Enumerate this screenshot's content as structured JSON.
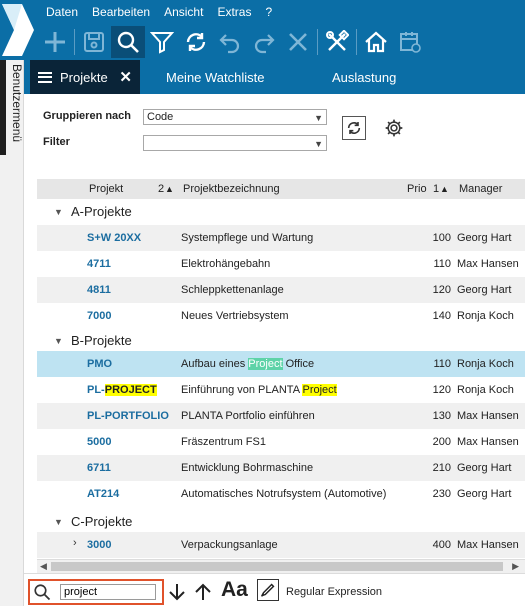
{
  "menu": [
    "Daten",
    "Bearbeiten",
    "Ansicht",
    "Extras",
    "?"
  ],
  "toolbar": {
    "icons": [
      "plus-icon",
      "save-icon",
      "search-icon",
      "filter-icon",
      "refresh-icon",
      "undo-icon",
      "redo-icon",
      "close-icon",
      "tools-icon",
      "home-icon",
      "calendar-icon"
    ],
    "active": "search-icon"
  },
  "side_rail": {
    "label": "Benutzermenü"
  },
  "tabs": [
    {
      "label": "Projekte",
      "active": true
    },
    {
      "label": "Meine Watchliste",
      "active": false
    },
    {
      "label": "Auslastung",
      "active": false
    }
  ],
  "filters": {
    "group_label": "Gruppieren nach",
    "group_value": "Code",
    "filter_label": "Filter",
    "filter_value": ""
  },
  "table": {
    "columns": {
      "projekt": "Projekt",
      "sort2": "2",
      "bezeichnung": "Projektbezeichnung",
      "prio": "Prio",
      "sort1": "1",
      "manager": "Manager"
    },
    "groups": [
      {
        "title": "A-Projekte",
        "rows": [
          {
            "code": "S+W 20XX",
            "desc": "Systempflege und Wartung",
            "prio": "100",
            "manager": "Georg Hart"
          },
          {
            "code": "4711",
            "desc": "Elektrohängebahn",
            "prio": "110",
            "manager": "Max Hansen"
          },
          {
            "code": "4811",
            "desc": "Schleppkettenanlage",
            "prio": "120",
            "manager": "Georg Hart"
          },
          {
            "code": "7000",
            "desc": "Neues Vertriebsystem",
            "prio": "140",
            "manager": "Ronja Koch"
          }
        ]
      },
      {
        "title": "B-Projekte",
        "rows": [
          {
            "code": "PMO",
            "desc_pre": "Aufbau eines ",
            "desc_hl": "Project",
            "desc_post": " Office",
            "prio": "110",
            "manager": "Ronja Koch"
          },
          {
            "code_pre": "PL-",
            "code_hl": "PROJECT",
            "desc_pre": "Einführung von PLANTA ",
            "desc_hl": "Project",
            "desc_post": "",
            "prio": "120",
            "manager": "Ronja Koch"
          },
          {
            "code": "PL-PORTFOLIO",
            "desc": "PLANTA Portfolio einführen",
            "prio": "130",
            "manager": "Max Hansen"
          },
          {
            "code": "5000",
            "desc": "Fräszentrum FS1",
            "prio": "200",
            "manager": "Max Hansen"
          },
          {
            "code": "6711",
            "desc": "Entwicklung Bohrmaschine",
            "prio": "210",
            "manager": "Georg Hart"
          },
          {
            "code": "AT214",
            "desc": "Automatisches Notrufsystem (Automotive)",
            "prio": "230",
            "manager": "Georg Hart"
          }
        ]
      },
      {
        "title": "C-Projekte",
        "rows": [
          {
            "code": "3000",
            "desc": "Verpackungsanlage",
            "prio": "400",
            "manager": "Max Hansen"
          }
        ]
      }
    ]
  },
  "search": {
    "value": "project",
    "case_icon": "Aa",
    "regex_label": "Regular Expression"
  },
  "colors": {
    "brand_blue": "#0b6ea6",
    "active_tab": "#0a2438",
    "code_blue": "#1b6da0",
    "selected_row": "#bee3f2",
    "highlight_current": "#5ed3a8",
    "highlight_match": "#ffff00",
    "search_border": "#e0522b"
  }
}
